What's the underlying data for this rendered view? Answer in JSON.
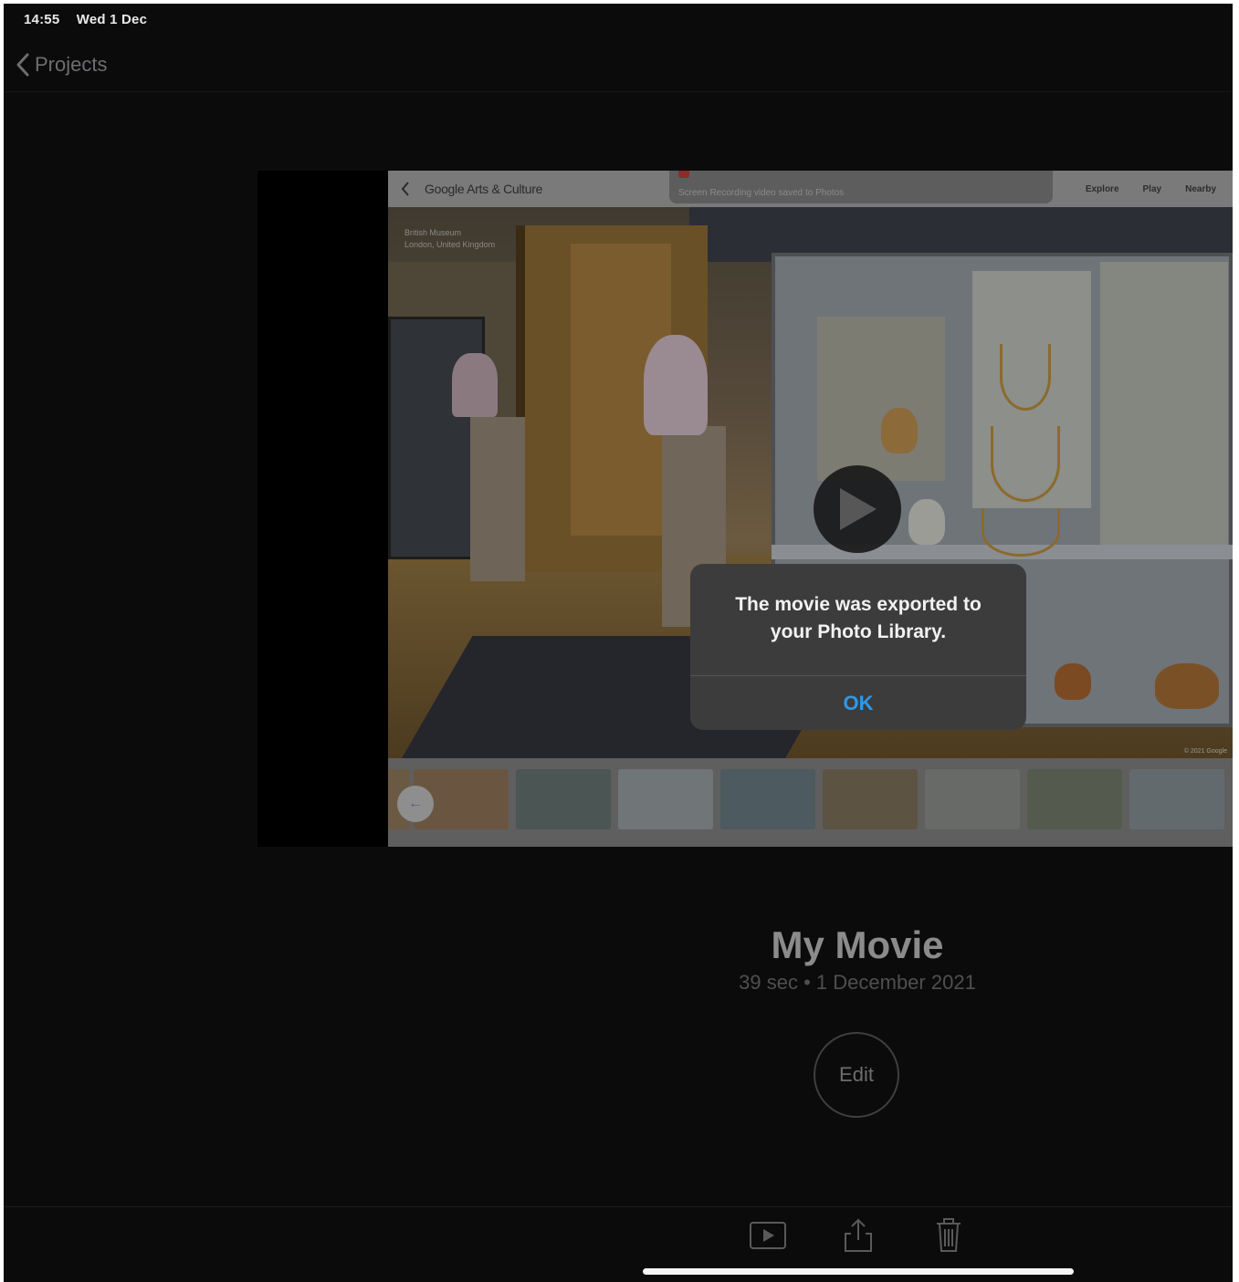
{
  "status_bar": {
    "time": "14:55",
    "date": "Wed 1 Dec"
  },
  "nav": {
    "back_label": "Projects"
  },
  "preview": {
    "app_brand": "Google Arts & Culture",
    "banner_text": "Screen Recording video saved to Photos",
    "menu": [
      "Explore",
      "Play",
      "Nearby"
    ],
    "location_name": "British Museum",
    "location_place": "London, United Kingdom",
    "copyright": "© 2021 Google"
  },
  "alert": {
    "message": "The movie was exported to your Photo Library.",
    "ok_label": "OK"
  },
  "project": {
    "title": "My Movie",
    "subtitle": "39 sec • 1 December 2021",
    "edit_label": "Edit"
  },
  "toolbar": {
    "icons": [
      "play-icon",
      "share-icon",
      "trash-icon"
    ]
  },
  "colors": {
    "accent": "#2f98e8",
    "background": "#0b0b0b",
    "alert_bg": "#3c3c3d"
  }
}
